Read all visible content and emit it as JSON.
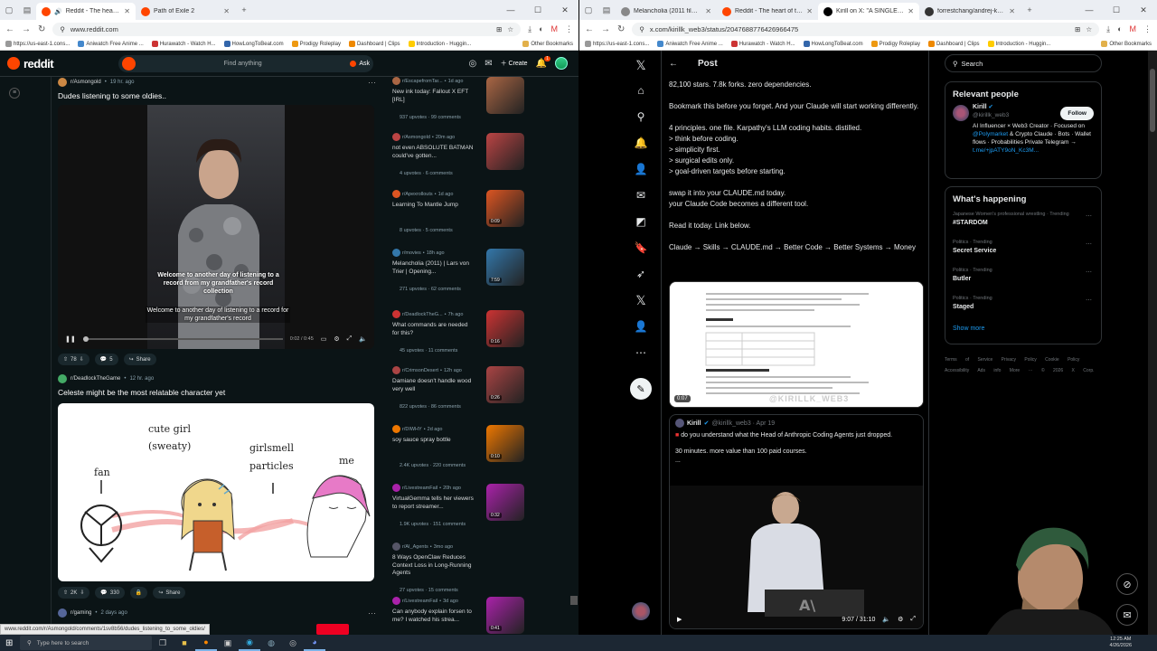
{
  "left_window": {
    "tabs": [
      {
        "title": "Reddit - The heart of the int",
        "active": true,
        "color": "#ff4500"
      },
      {
        "title": "Path of Exile 2",
        "active": false,
        "color": "#ff4500"
      }
    ],
    "url": "www.reddit.com",
    "bookmarks": [
      "https://us-east-1.cons...",
      "Aniwatch Free Anime ...",
      "Hurawatch - Watch H...",
      "HowLongToBeat.com",
      "Prodigy Roleplay",
      "Dashboard | Clips",
      "Introduction - Huggin..."
    ],
    "other_bookmarks": "Other Bookmarks"
  },
  "reddit": {
    "logo": "reddit",
    "search_placeholder": "Find anything",
    "ask_label": "Ask",
    "create_label": "Create",
    "notif_count": "1",
    "posts": [
      {
        "subreddit": "r/Asmongold",
        "age": "19 hr. ago",
        "title": "Dudes listening to some oldies..",
        "caption_top": "Welcome to another day of listening to a record from my grandfather's record collection",
        "caption_bottom": "Welcome to another day of listening to a record for my grandfather's record",
        "time_label": "0:02 / 0:45",
        "votes": "78",
        "comments": "5",
        "share": "Share"
      },
      {
        "subreddit": "r/DeadlockTheGame",
        "age": "12 hr. ago",
        "title": "Celeste might be the most relatable character yet",
        "labels": {
          "fan": "fan",
          "cute_girl": "cute girl",
          "sweaty": "(sweaty)",
          "girlsmell": "girlsmell",
          "particles": "particles",
          "me": "me"
        },
        "votes": "2K",
        "comments": "330",
        "share": "Share"
      },
      {
        "subreddit": "r/gaming",
        "age": "2 days ago"
      }
    ],
    "sidebar": [
      {
        "sub": "r/EscapefromTar...",
        "age": "1d ago",
        "title": "New ink today: Fallout X EFT [IRL]",
        "stats": "937 upvotes · 99 comments",
        "color": "#a64",
        "dur": ""
      },
      {
        "sub": "r/Asmongold",
        "age": "20m ago",
        "title": "not even ABSOLUTE BATMAN could've gotten...",
        "stats": "4 upvotes · 6 comments",
        "color": "#b44",
        "dur": ""
      },
      {
        "sub": "r/Apexrollouts",
        "age": "1d ago",
        "title": "Learning To Mantle Jump",
        "stats": "8 upvotes · 5 comments",
        "color": "#d52",
        "dur": "0:09"
      },
      {
        "sub": "r/movies",
        "age": "18h ago",
        "title": "Melancholia (2011) | Lars von Trier | Opening...",
        "stats": "271 upvotes · 62 comments",
        "color": "#37a",
        "dur": "7:59"
      },
      {
        "sub": "r/DeadlockTheG...",
        "age": "7h ago",
        "title": "What commands are needed for this?",
        "stats": "45 upvotes · 11 comments",
        "color": "#c33",
        "dur": "0:16"
      },
      {
        "sub": "r/CrimsonDesert",
        "age": "12h ago",
        "title": "Damiane doesn't handle wood very well",
        "stats": "822 upvotes · 86 comments",
        "color": "#a44",
        "dur": "0:26"
      },
      {
        "sub": "r/DIWHY",
        "age": "2d ago",
        "title": "soy sauce spray bottle",
        "stats": "2.4K upvotes · 220 comments",
        "color": "#e70",
        "dur": "0:10"
      },
      {
        "sub": "r/LivestreamFail",
        "age": "20h ago",
        "title": "VirtualGemma tells her viewers to report streamer...",
        "stats": "1.9K upvotes · 151 comments",
        "color": "#a2a",
        "dur": "0:32"
      },
      {
        "sub": "r/AI_Agents",
        "age": "3mo ago",
        "title": "8 Ways OpenClaw Reduces Context Loss in Long-Running Agents",
        "stats": "27 upvotes · 15 comments",
        "color": "#556",
        "dur": ""
      },
      {
        "sub": "r/LivestreamFail",
        "age": "3d ago",
        "title": "Can anybody explain forsen to me? I watched his strea...",
        "stats": "",
        "color": "#a2a",
        "dur": "0:41"
      }
    ],
    "status_url": "www.reddit.com/r/Asmongold/comments/1sv8b56/dudes_listening_to_some_oldies/"
  },
  "right_window": {
    "tabs": [
      {
        "title": "Melancholia (2011 film) - Wikip",
        "active": false,
        "color": "#888"
      },
      {
        "title": "Reddit - The heart of the intern",
        "active": false,
        "color": "#ff4500"
      },
      {
        "title": "Kirill on X: \"A SINGLE CLAUDE.n",
        "active": true,
        "color": "#000"
      },
      {
        "title": "forrestchang/andrej-karpathy-",
        "active": false,
        "color": "#333"
      }
    ],
    "url": "x.com/kirillk_web3/status/2047688776426966475"
  },
  "x": {
    "header": "Post",
    "tweet_lines": [
      "82,100 stars. 7.8k forks. zero dependencies.",
      "Bookmark this before you forget. And your Claude will start working differently.",
      "4 principles. one file. Karpathy's LLM coding habits. distilled.\n> think before coding.\n> simplicity first.\n> surgical edits only.\n> goal-driven targets before starting.",
      "swap it into your CLAUDE.md today.\nyour Claude Code becomes a different tool.",
      "Read it today. Link below.",
      "Claude → Skills → CLAUDE.md → Better Code → Better Systems → Money"
    ],
    "media_duration": "0:07",
    "media_watermark": "@KIRILLK_WEB3",
    "quote": {
      "name": "Kirill",
      "handle": "@kirillk_web3 · Apr 19",
      "text": "do you understand what the Head of Anthropic Coding Agents just dropped.",
      "text2": "30 minutes. more value than 100 paid courses.",
      "more": "...",
      "time": "9:07 / 31:10"
    },
    "search_placeholder": "Search",
    "relevant_people": {
      "heading": "Relevant people",
      "name": "Kirill",
      "handle": "@kirillk_web3",
      "follow": "Follow",
      "bio1": "AI Influencer × Web3 Creator · Focused on",
      "bio_link1": "@Polymarket",
      "bio2": "& Crypto Claude · Bots · Wallet flows · Probabilities Private Telegram →",
      "bio_link2": "t.me/+jpATY9oN_Kc3M..."
    },
    "happening": {
      "heading": "What's happening",
      "items": [
        {
          "context": "Japanese Women's professional wrestling · Trending",
          "name": "#STARDOM"
        },
        {
          "context": "Politics · Trending",
          "name": "Secret Service"
        },
        {
          "context": "Politics · Trending",
          "name": "Butler"
        },
        {
          "context": "Politics · Trending",
          "name": "Staged"
        }
      ],
      "show_more": "Show more"
    },
    "footer": "Terms of Service  Privacy Policy  Cookie Policy  Accessibility  Ads info  More ···  © 2026 X Corp."
  },
  "taskbar": {
    "search_placeholder": "Type here to search",
    "time": "12:25 AM",
    "date": "4/26/2026"
  }
}
